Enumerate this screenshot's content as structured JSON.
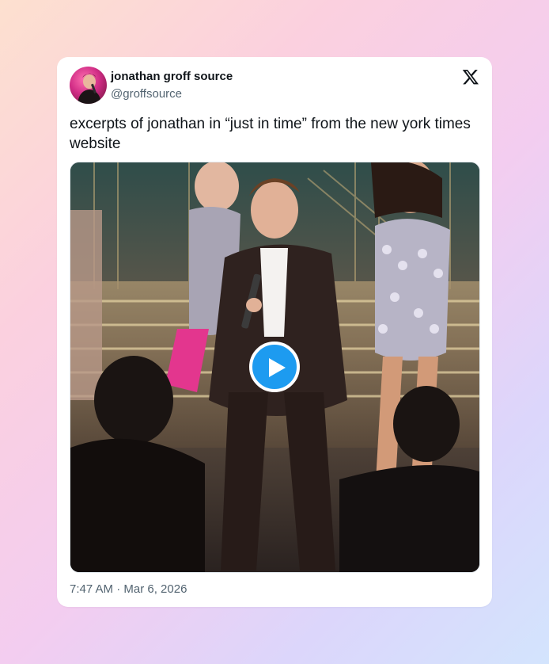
{
  "author": {
    "display_name": "jonathan groff source",
    "handle": "@groffsource",
    "avatar_icon": "profile-photo"
  },
  "platform_icon": "x-logo-icon",
  "tweet": {
    "text": "excerpts of jonathan in “just in time” from the new york times website",
    "media": {
      "type": "video",
      "play_icon": "play-icon",
      "accent_color": "#1d9bf0"
    },
    "timestamp": "7:47 AM · Mar 6, 2026"
  }
}
